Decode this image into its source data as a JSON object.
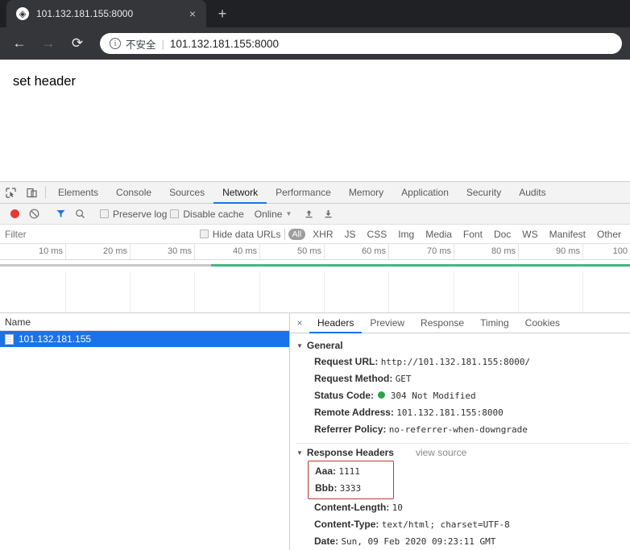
{
  "browser": {
    "tab": {
      "title": "101.132.181.155:8000",
      "favicon_icon": "globe-icon",
      "close_icon": "×"
    },
    "newtab_icon": "+",
    "nav": {
      "back_icon": "←",
      "forward_icon": "→",
      "reload_icon": "⟳"
    },
    "address": {
      "security_icon": "i",
      "security_text": "不安全",
      "separator": "|",
      "url": "101.132.181.155:8000"
    }
  },
  "page": {
    "body_text": "set header"
  },
  "devtools": {
    "left_icons": [
      {
        "name": "inspect-element-icon",
        "glyph": "⬚"
      },
      {
        "name": "device-toolbar-icon",
        "glyph": "▭"
      }
    ],
    "panels": [
      {
        "label": "Elements",
        "active": false
      },
      {
        "label": "Console",
        "active": false
      },
      {
        "label": "Sources",
        "active": false
      },
      {
        "label": "Network",
        "active": true
      },
      {
        "label": "Performance",
        "active": false
      },
      {
        "label": "Memory",
        "active": false
      },
      {
        "label": "Application",
        "active": false
      },
      {
        "label": "Security",
        "active": false
      },
      {
        "label": "Audits",
        "active": false
      }
    ],
    "network_toolbar": {
      "record_icon": "record-icon",
      "clear_icon": "⊘",
      "filter_icon": "▼",
      "search_icon": "⚲",
      "preserve_log_label": "Preserve log",
      "disable_cache_label": "Disable cache",
      "throttle_value": "Online",
      "throttle_caret": "▼",
      "import_icon": "⬆",
      "export_icon": "⬇"
    },
    "filter_bar": {
      "filter_placeholder": "Filter",
      "filter_value": "",
      "hide_data_urls_label": "Hide data URLs",
      "types": [
        {
          "label": "All",
          "active": true
        },
        {
          "label": "XHR",
          "active": false
        },
        {
          "label": "JS",
          "active": false
        },
        {
          "label": "CSS",
          "active": false
        },
        {
          "label": "Img",
          "active": false
        },
        {
          "label": "Media",
          "active": false
        },
        {
          "label": "Font",
          "active": false
        },
        {
          "label": "Doc",
          "active": false
        },
        {
          "label": "WS",
          "active": false
        },
        {
          "label": "Manifest",
          "active": false
        },
        {
          "label": "Other",
          "active": false
        }
      ]
    },
    "timeline": {
      "ticks": [
        "10 ms",
        "20 ms",
        "30 ms",
        "40 ms",
        "50 ms",
        "60 ms",
        "70 ms",
        "80 ms",
        "90 ms",
        "100"
      ]
    },
    "request_list": {
      "column_header": "Name",
      "rows": [
        {
          "name": "101.132.181.155",
          "selected": true,
          "icon": "document-icon"
        }
      ]
    },
    "detail": {
      "close_icon": "×",
      "tabs": [
        {
          "label": "Headers",
          "active": true
        },
        {
          "label": "Preview",
          "active": false
        },
        {
          "label": "Response",
          "active": false
        },
        {
          "label": "Timing",
          "active": false
        },
        {
          "label": "Cookies",
          "active": false
        }
      ],
      "general": {
        "title": "General",
        "rows": [
          {
            "name": "Request URL:",
            "value": "http://101.132.181.155:8000/"
          },
          {
            "name": "Request Method:",
            "value": "GET"
          },
          {
            "name": "Status Code:",
            "value": "304 Not Modified",
            "has_status_dot": true,
            "status_color": "#30a14e"
          },
          {
            "name": "Remote Address:",
            "value": "101.132.181.155:8000"
          },
          {
            "name": "Referrer Policy:",
            "value": "no-referrer-when-downgrade"
          }
        ]
      },
      "response_headers": {
        "title": "Response Headers",
        "view_source_label": "view source",
        "highlight_color": "#c0392b",
        "highlighted_rows": [
          {
            "name": "Aaa:",
            "value": "1111"
          },
          {
            "name": "Bbb:",
            "value": "3333"
          }
        ],
        "rows": [
          {
            "name": "Content-Length:",
            "value": "10"
          },
          {
            "name": "Content-Type:",
            "value": "text/html; charset=UTF-8"
          },
          {
            "name": "Date:",
            "value": "Sun, 09 Feb 2020 09:23:11 GMT"
          }
        ]
      }
    }
  }
}
